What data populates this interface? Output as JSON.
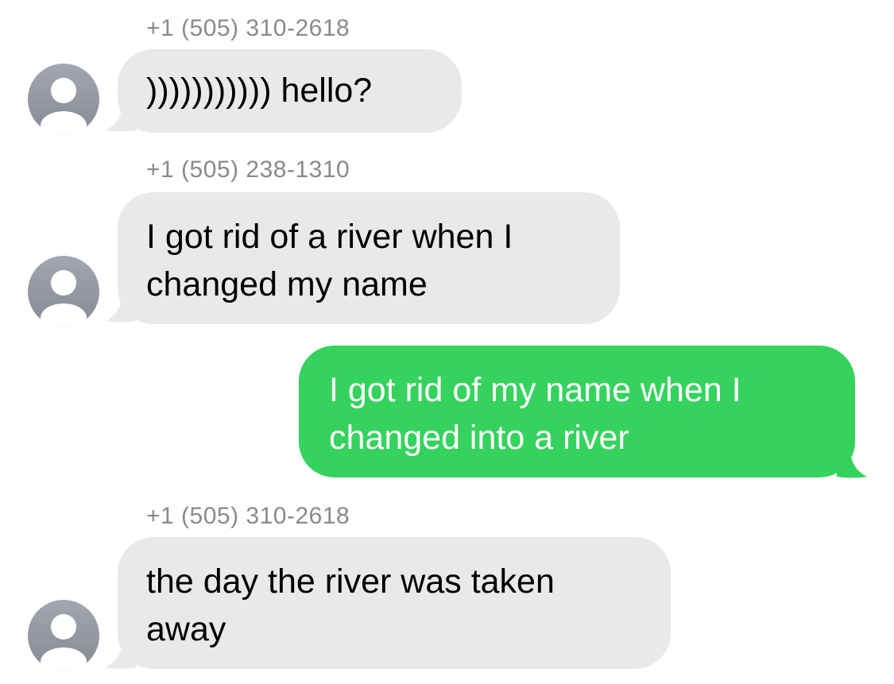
{
  "conversation": {
    "messages": [
      {
        "direction": "incoming",
        "sender": "+1 (505) 310-2618",
        "text": "))))))))))) hello?",
        "avatar_icon": "person-placeholder-icon"
      },
      {
        "direction": "incoming",
        "sender": "+1 (505) 238-1310",
        "text": "I got rid of a river when I\nchanged my name",
        "avatar_icon": "person-placeholder-icon"
      },
      {
        "direction": "outgoing",
        "text": "I got rid of my name when I\nchanged into a river"
      },
      {
        "direction": "incoming",
        "sender": "+1 (505) 310-2618",
        "text": "the day the river was taken\naway",
        "avatar_icon": "person-placeholder-icon"
      }
    ]
  },
  "colors": {
    "incoming_bubble": "#e9e9eb",
    "outgoing_bubble": "#35d35d",
    "sender_label": "#8a8a8e",
    "avatar": "#8e919c"
  }
}
